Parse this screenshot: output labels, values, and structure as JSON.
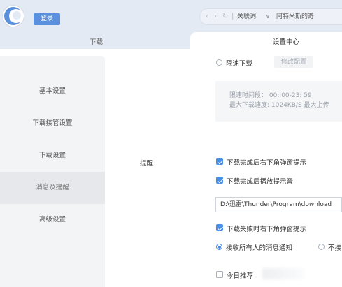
{
  "topbar": {
    "login_label": "登录",
    "nav_back": "‹",
    "nav_forward": "›",
    "nav_refresh": "↻",
    "separator": "|",
    "keyword_label": "关联词",
    "dropdown_arrow": "∨",
    "query_text": "阿特米斯的奇"
  },
  "tabs": {
    "download": "下载",
    "settings": "设置中心"
  },
  "sidebar": {
    "items": [
      {
        "label": "基本设置"
      },
      {
        "label": "下载接管设置"
      },
      {
        "label": "下载设置"
      },
      {
        "label": "消息及提醒"
      },
      {
        "label": "高级设置"
      }
    ]
  },
  "main": {
    "limit_download_label": "限速下载",
    "modify_config_label": "修改配置",
    "limit_time_text": "限速时间段： 00: 00-23: 59",
    "limit_speed_text": "最大下载速度: 1024KB/S   最大上传",
    "section_title": "提醒",
    "options": [
      {
        "label": "下载完成后右下角弹窗提示",
        "checked": true
      },
      {
        "label": "下载完成后播放提示音",
        "checked": true
      }
    ],
    "sound_path": "D:\\迅雷\\Thunder\\Program\\download",
    "fail_popup_label": "下载失败时右下角弹窗提示",
    "fail_popup_checked": true,
    "receive_all_label": "接收所有人的消息通知",
    "no_receive_label": "不接",
    "today_recommend_label": "今日推荐",
    "today_recommend_checked": false
  },
  "colors": {
    "accent": "#4a8fe7",
    "topbar_bg": "#e4eaf3",
    "sidebar_bg": "#f3f4f6",
    "sidebar_active": "#e6e8ec"
  },
  "icons": [
    "thunder-logo-icon",
    "back-icon",
    "forward-icon",
    "refresh-icon",
    "chevron-down-icon"
  ]
}
